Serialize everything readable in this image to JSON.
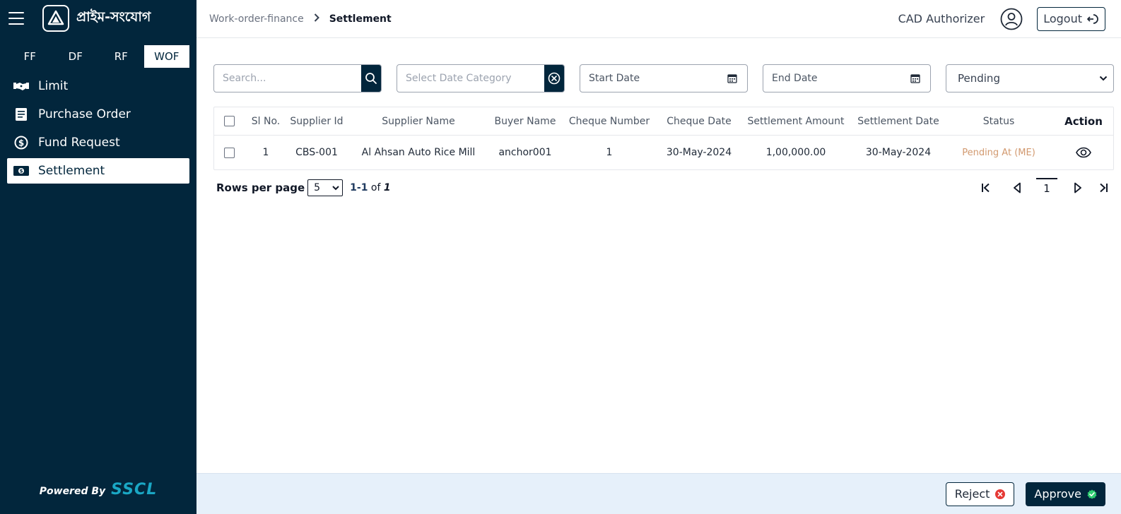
{
  "brand": {
    "name": "প্রাইম-সংযোগ"
  },
  "sidebar": {
    "tabs": [
      {
        "label": "FF",
        "active": false
      },
      {
        "label": "DF",
        "active": false
      },
      {
        "label": "RF",
        "active": false
      },
      {
        "label": "WOF",
        "active": true
      }
    ],
    "items": [
      {
        "label": "Limit",
        "icon": "handshake-icon"
      },
      {
        "label": "Purchase Order",
        "icon": "document-icon"
      },
      {
        "label": "Fund Request",
        "icon": "dollar-circle-icon"
      },
      {
        "label": "Settlement",
        "icon": "cash-icon",
        "active": true
      }
    ],
    "powered_by": "Powered By",
    "powered_brand": "SSCL"
  },
  "header": {
    "breadcrumb": [
      "Work-order-finance",
      "Settlement"
    ],
    "role": "CAD Authorizer",
    "logout_label": "Logout"
  },
  "filters": {
    "search_placeholder": "Search...",
    "date_category_placeholder": "Select Date Category",
    "start_date": "Start Date",
    "end_date": "End Date",
    "status_value": "Pending"
  },
  "table": {
    "columns": [
      "Sl No.",
      "Supplier Id",
      "Supplier Name",
      "Buyer Name",
      "Cheque Number",
      "Cheque Date",
      "Settlement Amount",
      "Settlement Date",
      "Status",
      "Action"
    ],
    "rows": [
      {
        "sl": "1",
        "supplier_id": "CBS-001",
        "supplier_name": "Al Ahsan Auto Rice Mill",
        "buyer_name": "anchor001",
        "cheque_number": "1",
        "cheque_date": "30-May-2024",
        "amount": "1,00,000.00",
        "settlement_date": "30-May-2024",
        "status": "Pending At (ME)"
      }
    ]
  },
  "pagination": {
    "rows_per_page_label": "Rows per page",
    "rows_per_page": "5",
    "range": "1-1",
    "of": "of",
    "total": "1",
    "current_page": "1"
  },
  "footer": {
    "reject_label": "Reject",
    "approve_label": "Approve"
  },
  "colors": {
    "sidebar_bg": "#02263c",
    "accent": "#1aa7c4",
    "status_pending": "#d2996f",
    "footer_bg": "#e6f0fa",
    "reject_icon": "#e53935",
    "approve_icon": "#2ecc71"
  }
}
